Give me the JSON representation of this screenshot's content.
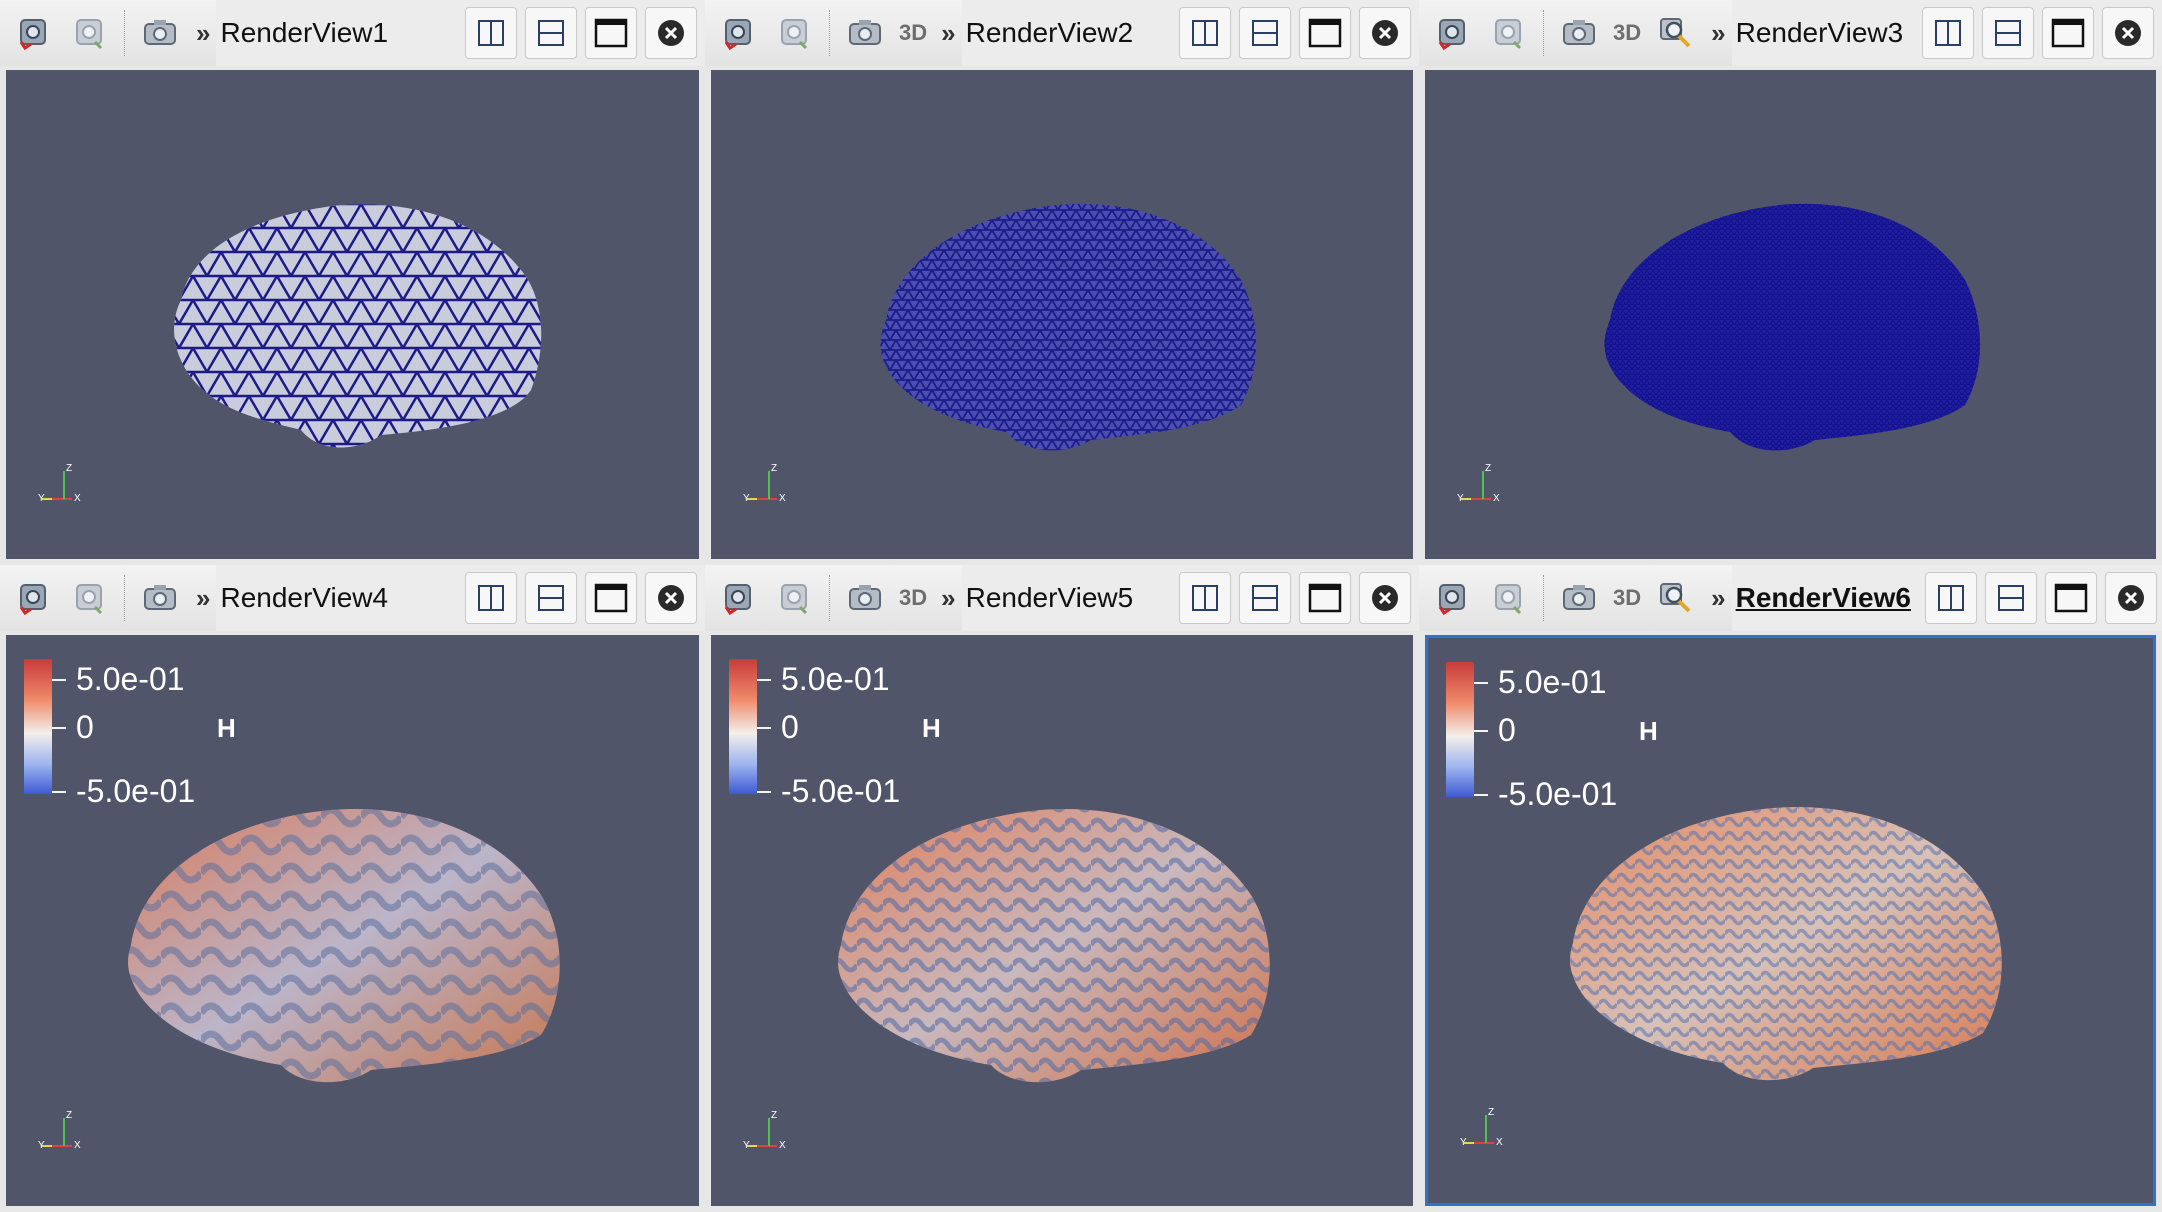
{
  "views": [
    {
      "title": "RenderView1",
      "show3d": false,
      "showZoom": false,
      "active": false
    },
    {
      "title": "RenderView2",
      "show3d": true,
      "showZoom": false,
      "active": false
    },
    {
      "title": "RenderView3",
      "show3d": true,
      "showZoom": true,
      "active": false
    },
    {
      "title": "RenderView4",
      "show3d": false,
      "showZoom": false,
      "active": false
    },
    {
      "title": "RenderView5",
      "show3d": true,
      "showZoom": false,
      "active": false
    },
    {
      "title": "RenderView6",
      "show3d": true,
      "showZoom": true,
      "active": true
    }
  ],
  "toolbar": {
    "label_3d": "3D",
    "more": "»"
  },
  "legend": {
    "max": "5.0e-01",
    "mid": "0",
    "min": "-5.0e-01",
    "name": "H",
    "colors": [
      "#c83b3b",
      "#f3efea",
      "#3f5ad3"
    ]
  },
  "axes": {
    "y": "Y",
    "x": "X",
    "z": "Z"
  },
  "colors": {
    "viewport_bg": "#515569",
    "mesh_line": "#1d1b8a",
    "active_border": "#2d74c9"
  }
}
